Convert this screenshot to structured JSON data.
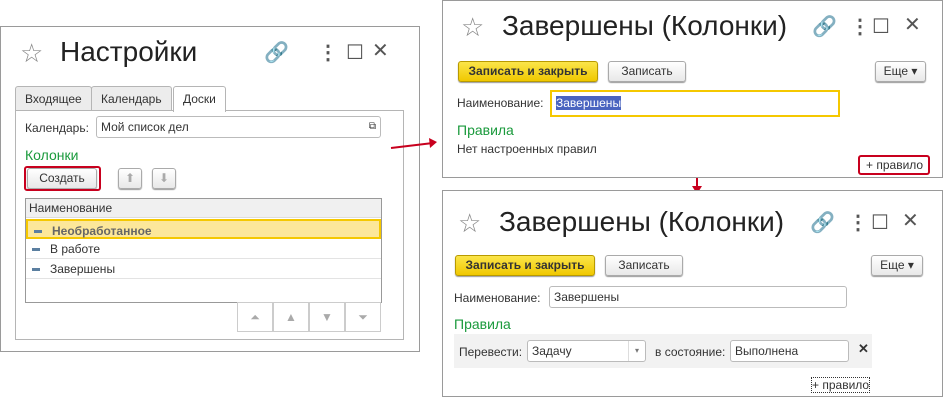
{
  "settings_window": {
    "title": "Настройки",
    "tabs": [
      "Входящее",
      "Календарь",
      "Доски"
    ],
    "calendar_label": "Календарь:",
    "calendar_value": "Мой список дел",
    "columns_heading": "Колонки",
    "create_button": "Создать",
    "table_header": "Наименование",
    "rows": [
      "Необработанное",
      "В работе",
      "Завершены"
    ]
  },
  "column_window_1": {
    "title": "Завершены (Колонки)",
    "save_close": "Записать и закрыть",
    "save": "Записать",
    "more": "Еще",
    "name_label": "Наименование:",
    "name_value": "Завершены",
    "rules_heading": "Правила",
    "no_rules": "Нет настроенных правил",
    "add_rule": "+ правило"
  },
  "column_window_2": {
    "title": "Завершены (Колонки)",
    "save_close": "Записать и закрыть",
    "save": "Записать",
    "more": "Еще",
    "name_label": "Наименование:",
    "name_value": "Завершены",
    "rules_heading": "Правила",
    "move_label": "Перевести:",
    "move_value": "Задачу",
    "state_label": "в состояние:",
    "state_value": "Выполнена",
    "add_rule": "+ правило"
  },
  "colors": {
    "accent": "#f0c800",
    "highlight": "#c8001e",
    "green": "#1a9a3c"
  }
}
